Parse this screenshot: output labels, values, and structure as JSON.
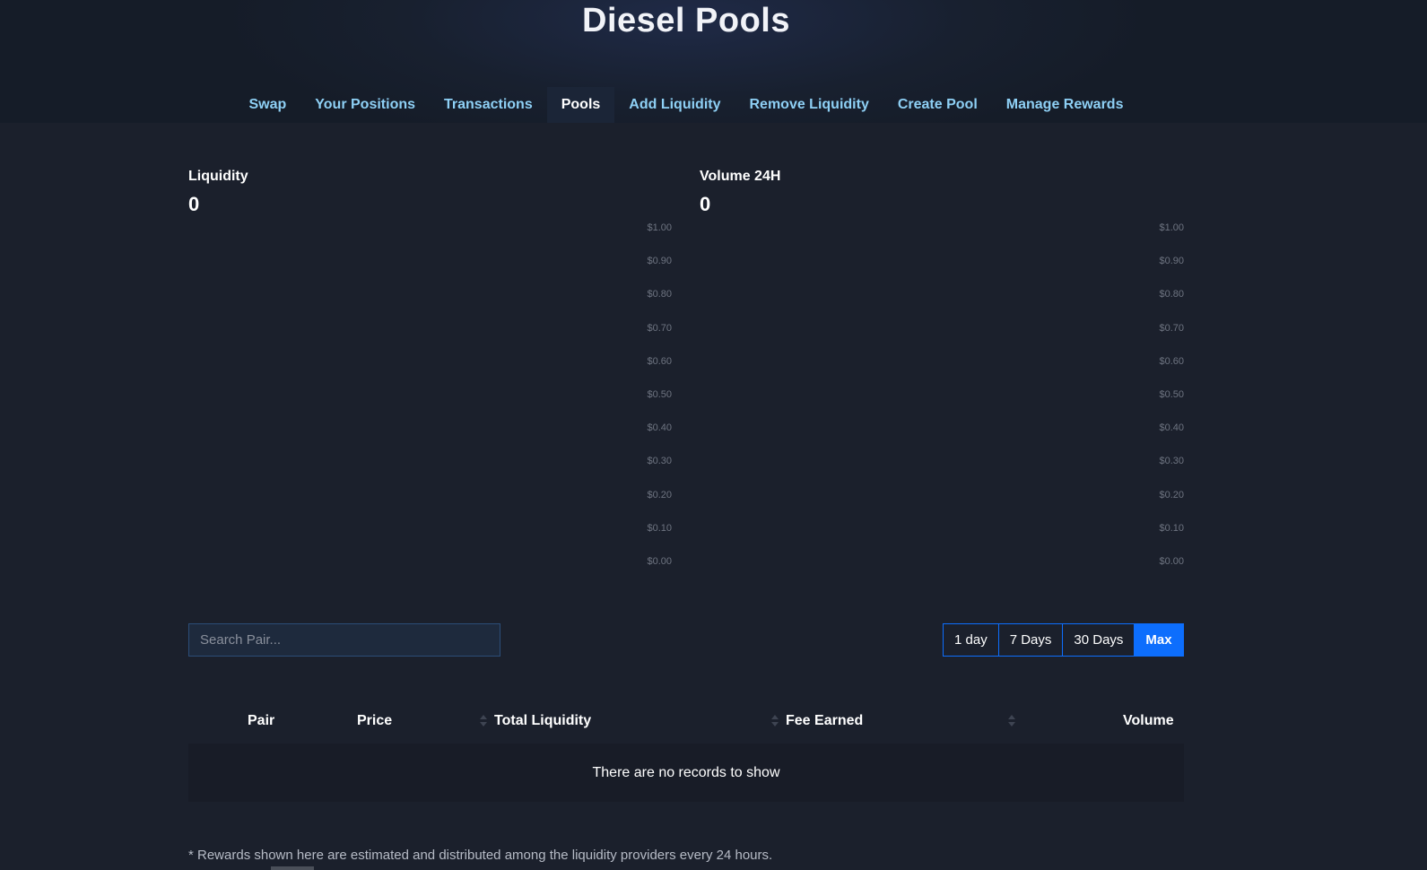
{
  "header": {
    "title": "Diesel Pools"
  },
  "nav": {
    "items": [
      {
        "label": "Swap",
        "active": false
      },
      {
        "label": "Your Positions",
        "active": false
      },
      {
        "label": "Transactions",
        "active": false
      },
      {
        "label": "Pools",
        "active": true
      },
      {
        "label": "Add Liquidity",
        "active": false
      },
      {
        "label": "Remove Liquidity",
        "active": false
      },
      {
        "label": "Create Pool",
        "active": false
      },
      {
        "label": "Manage Rewards",
        "active": false
      }
    ]
  },
  "charts": {
    "liquidity": {
      "label": "Liquidity",
      "value": "0"
    },
    "volume": {
      "label": "Volume 24H",
      "value": "0"
    }
  },
  "chart_data": [
    {
      "type": "area",
      "title": "Liquidity",
      "x": [],
      "series": [],
      "ylim": [
        0,
        1
      ],
      "ytick_labels": [
        "$1.00",
        "$0.90",
        "$0.80",
        "$0.70",
        "$0.60",
        "$0.50",
        "$0.40",
        "$0.30",
        "$0.20",
        "$0.10",
        "$0.00"
      ],
      "grid": false
    },
    {
      "type": "bar",
      "title": "Volume 24H",
      "x": [],
      "series": [],
      "ylim": [
        0,
        1
      ],
      "ytick_labels": [
        "$1.00",
        "$0.90",
        "$0.80",
        "$0.70",
        "$0.60",
        "$0.50",
        "$0.40",
        "$0.30",
        "$0.20",
        "$0.10",
        "$0.00"
      ],
      "grid": false
    }
  ],
  "search": {
    "placeholder": "Search Pair...",
    "value": ""
  },
  "range": {
    "options": [
      "1 day",
      "7 Days",
      "30 Days",
      "Max"
    ],
    "selected": "Max"
  },
  "table": {
    "columns": [
      "Pair",
      "Price",
      "Total Liquidity",
      "Fee Earned",
      "Volume"
    ],
    "empty_message": "There are no records to show"
  },
  "footnote": "* Rewards shown here are estimated and distributed among the liquidity providers every 24 hours.",
  "colors": {
    "background": "#1b202c",
    "accent": "#0d6efd",
    "nav_link": "#8ed0f5",
    "axis_text": "#6e7481"
  }
}
